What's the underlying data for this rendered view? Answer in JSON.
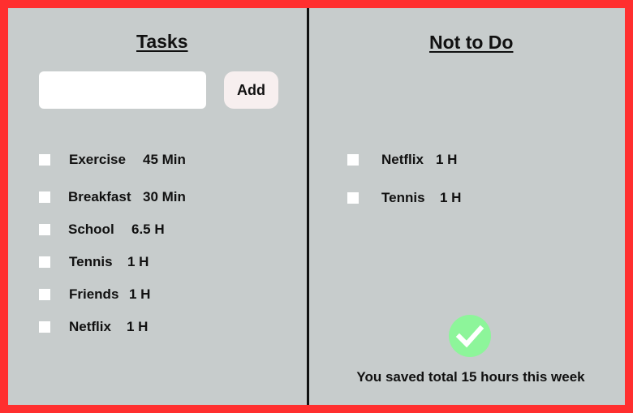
{
  "tasks": {
    "title": "Tasks",
    "input_value": "",
    "input_placeholder": "",
    "add_label": "Add",
    "items": [
      {
        "name": "Exercise",
        "duration": "45 Min",
        "checked": false
      },
      {
        "name": "Breakfast",
        "duration": "30 Min",
        "checked": false
      },
      {
        "name": "School",
        "duration": "6.5 H",
        "checked": false
      },
      {
        "name": "Tennis",
        "duration": "1 H",
        "checked": false
      },
      {
        "name": "Friends",
        "duration": "1 H",
        "checked": false
      },
      {
        "name": "Netflix",
        "duration": "1 H",
        "checked": false
      }
    ]
  },
  "not_to_do": {
    "title": "Not to Do",
    "items": [
      {
        "name": "Netflix",
        "duration": "1 H",
        "checked": false
      },
      {
        "name": "Tennis",
        "duration": "1 H",
        "checked": false
      }
    ],
    "saved_message": "You saved total 15 hours this week",
    "saved_icon": "checkmark-circle-icon"
  },
  "colors": {
    "border": "#ff2f2f",
    "panel": "#c7cccc",
    "check_badge": "#8df59a",
    "add_button": "#f7efef"
  }
}
